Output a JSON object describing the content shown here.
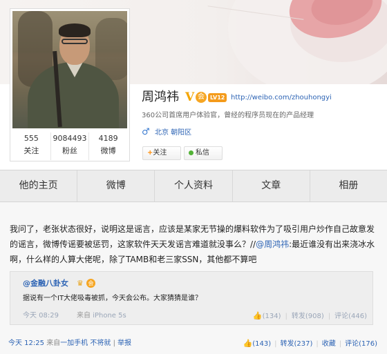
{
  "profile": {
    "name": "周鸿祎",
    "level": "LV12",
    "homepage_url": "http://weibo.com/zhouhongyi",
    "description": "360公司首席用户体验官，曾经的程序员现在的产品经理",
    "gender_icon": "♂",
    "location": "北京 朝阳区",
    "stats": [
      {
        "value": "555",
        "label": "关注"
      },
      {
        "value": "9084493",
        "label": "粉丝"
      },
      {
        "value": "4189",
        "label": "微博"
      }
    ],
    "follow_button": "关注",
    "message_button": "私信"
  },
  "tabs": [
    "他的主页",
    "微博",
    "个人资料",
    "文章",
    "相册"
  ],
  "post": {
    "text_before_mention": "我问了，老张状态很好，说明这是谣言，应该是某家无节操的爆料软件为了吸引用户炒作自己故意发的谣言，微博传谣要被惩罚，这家软件天天发谣言难道就没事么？//",
    "mention": "@周鸿祎",
    "text_after_mention": ":最近谁没有出来浇冰水啊，什么样的人算大佬呢，除了TAMB和老三家SSN，其他都不算吧",
    "repost": {
      "author": "@金融八卦女",
      "text": "据说有一个IT大佬吸毒被抓，今天会公布。大家猜猜是谁？",
      "time": "今天 08:29",
      "source_label": "来自",
      "source": "iPhone 5s",
      "likes": "(134)",
      "reposts": "转发(908)",
      "comments": "评论(446)"
    },
    "time": "今天 12:25",
    "source_label": "来自",
    "source": "一加手机 不将就",
    "report": "举报",
    "likes": "(143)",
    "reposts": "转发(237)",
    "favorite": "收藏",
    "comments": "评论(176)"
  },
  "icons": {
    "verified": "V",
    "vip": "会",
    "thumb": "👍",
    "crown": "♛"
  },
  "colors": {
    "link": "#2c63b4",
    "verified": "#f4a500",
    "follow_plus": "#ff8a00",
    "online_dot": "#53b237"
  }
}
